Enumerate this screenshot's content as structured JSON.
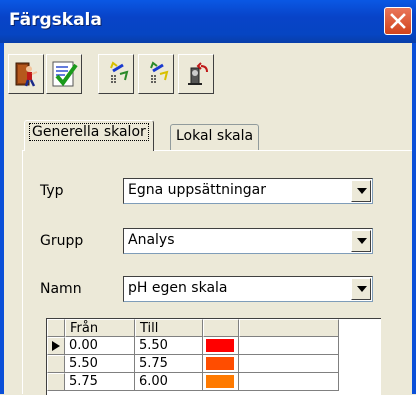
{
  "window": {
    "title": "Färgskala"
  },
  "toolbar": {
    "buttons": [
      {
        "name": "exit-button",
        "icon": "exit-door-icon"
      },
      {
        "name": "approve-button",
        "icon": "checkmark-icon"
      },
      {
        "name": "import-button",
        "icon": "edit-list-icon"
      },
      {
        "name": "export-button",
        "icon": "edit-list-icon"
      },
      {
        "name": "undo-button",
        "icon": "undo-icon"
      }
    ]
  },
  "tabs": [
    {
      "label": "Generella skalor",
      "active": true
    },
    {
      "label": "Lokal skala",
      "active": false
    }
  ],
  "form": {
    "typ": {
      "label": "Typ",
      "value": "Egna uppsättningar"
    },
    "grupp": {
      "label": "Grupp",
      "value": "Analys"
    },
    "namn": {
      "label": "Namn",
      "value": "pH egen skala"
    }
  },
  "grid": {
    "headers": [
      "Från",
      "Till",
      ""
    ],
    "rows": [
      {
        "from": "0.00",
        "to": "5.50",
        "color": "#ff0000",
        "current": true
      },
      {
        "from": "5.50",
        "to": "5.75",
        "color": "#ff4d00",
        "current": false
      },
      {
        "from": "5.75",
        "to": "6.00",
        "color": "#ff7a00",
        "current": false
      }
    ]
  },
  "colors": {
    "titlebar": "#0a58e4",
    "dialog": "#ece9d8",
    "close": "#d2431c"
  }
}
